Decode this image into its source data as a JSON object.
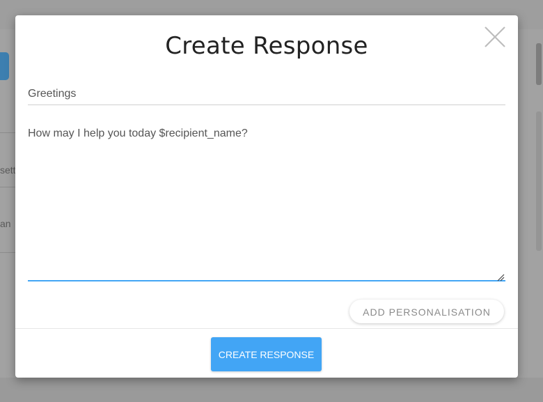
{
  "background": {
    "fragment_1": "sett",
    "fragment_2": "an"
  },
  "modal": {
    "title": "Create Response",
    "close_icon": "close-icon",
    "title_field": {
      "value": "Greetings"
    },
    "message_field": {
      "value": "How may I help you today $recipient_name?"
    },
    "personalise_label": "ADD PERSONALISATION",
    "submit_label": "CREATE RESPONSE",
    "accent_color": "#42a5f5"
  }
}
